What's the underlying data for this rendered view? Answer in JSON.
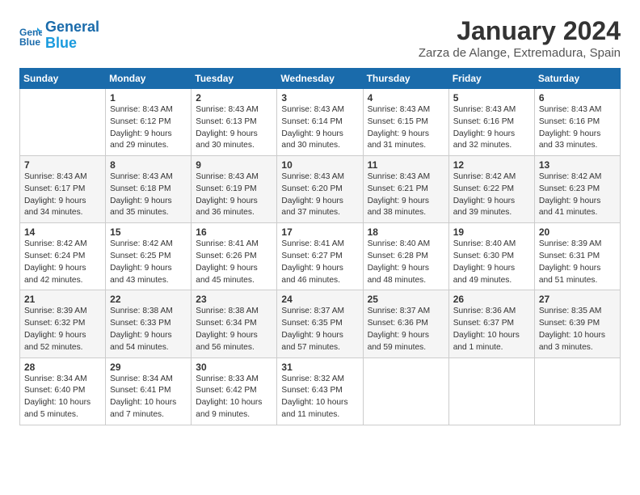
{
  "header": {
    "logo_line1": "General",
    "logo_line2": "Blue",
    "title": "January 2024",
    "subtitle": "Zarza de Alange, Extremadura, Spain"
  },
  "weekdays": [
    "Sunday",
    "Monday",
    "Tuesday",
    "Wednesday",
    "Thursday",
    "Friday",
    "Saturday"
  ],
  "rows": [
    [
      {
        "num": "",
        "lines": []
      },
      {
        "num": "1",
        "lines": [
          "Sunrise: 8:43 AM",
          "Sunset: 6:12 PM",
          "Daylight: 9 hours",
          "and 29 minutes."
        ]
      },
      {
        "num": "2",
        "lines": [
          "Sunrise: 8:43 AM",
          "Sunset: 6:13 PM",
          "Daylight: 9 hours",
          "and 30 minutes."
        ]
      },
      {
        "num": "3",
        "lines": [
          "Sunrise: 8:43 AM",
          "Sunset: 6:14 PM",
          "Daylight: 9 hours",
          "and 30 minutes."
        ]
      },
      {
        "num": "4",
        "lines": [
          "Sunrise: 8:43 AM",
          "Sunset: 6:15 PM",
          "Daylight: 9 hours",
          "and 31 minutes."
        ]
      },
      {
        "num": "5",
        "lines": [
          "Sunrise: 8:43 AM",
          "Sunset: 6:16 PM",
          "Daylight: 9 hours",
          "and 32 minutes."
        ]
      },
      {
        "num": "6",
        "lines": [
          "Sunrise: 8:43 AM",
          "Sunset: 6:16 PM",
          "Daylight: 9 hours",
          "and 33 minutes."
        ]
      }
    ],
    [
      {
        "num": "7",
        "lines": [
          "Sunrise: 8:43 AM",
          "Sunset: 6:17 PM",
          "Daylight: 9 hours",
          "and 34 minutes."
        ]
      },
      {
        "num": "8",
        "lines": [
          "Sunrise: 8:43 AM",
          "Sunset: 6:18 PM",
          "Daylight: 9 hours",
          "and 35 minutes."
        ]
      },
      {
        "num": "9",
        "lines": [
          "Sunrise: 8:43 AM",
          "Sunset: 6:19 PM",
          "Daylight: 9 hours",
          "and 36 minutes."
        ]
      },
      {
        "num": "10",
        "lines": [
          "Sunrise: 8:43 AM",
          "Sunset: 6:20 PM",
          "Daylight: 9 hours",
          "and 37 minutes."
        ]
      },
      {
        "num": "11",
        "lines": [
          "Sunrise: 8:43 AM",
          "Sunset: 6:21 PM",
          "Daylight: 9 hours",
          "and 38 minutes."
        ]
      },
      {
        "num": "12",
        "lines": [
          "Sunrise: 8:42 AM",
          "Sunset: 6:22 PM",
          "Daylight: 9 hours",
          "and 39 minutes."
        ]
      },
      {
        "num": "13",
        "lines": [
          "Sunrise: 8:42 AM",
          "Sunset: 6:23 PM",
          "Daylight: 9 hours",
          "and 41 minutes."
        ]
      }
    ],
    [
      {
        "num": "14",
        "lines": [
          "Sunrise: 8:42 AM",
          "Sunset: 6:24 PM",
          "Daylight: 9 hours",
          "and 42 minutes."
        ]
      },
      {
        "num": "15",
        "lines": [
          "Sunrise: 8:42 AM",
          "Sunset: 6:25 PM",
          "Daylight: 9 hours",
          "and 43 minutes."
        ]
      },
      {
        "num": "16",
        "lines": [
          "Sunrise: 8:41 AM",
          "Sunset: 6:26 PM",
          "Daylight: 9 hours",
          "and 45 minutes."
        ]
      },
      {
        "num": "17",
        "lines": [
          "Sunrise: 8:41 AM",
          "Sunset: 6:27 PM",
          "Daylight: 9 hours",
          "and 46 minutes."
        ]
      },
      {
        "num": "18",
        "lines": [
          "Sunrise: 8:40 AM",
          "Sunset: 6:28 PM",
          "Daylight: 9 hours",
          "and 48 minutes."
        ]
      },
      {
        "num": "19",
        "lines": [
          "Sunrise: 8:40 AM",
          "Sunset: 6:30 PM",
          "Daylight: 9 hours",
          "and 49 minutes."
        ]
      },
      {
        "num": "20",
        "lines": [
          "Sunrise: 8:39 AM",
          "Sunset: 6:31 PM",
          "Daylight: 9 hours",
          "and 51 minutes."
        ]
      }
    ],
    [
      {
        "num": "21",
        "lines": [
          "Sunrise: 8:39 AM",
          "Sunset: 6:32 PM",
          "Daylight: 9 hours",
          "and 52 minutes."
        ]
      },
      {
        "num": "22",
        "lines": [
          "Sunrise: 8:38 AM",
          "Sunset: 6:33 PM",
          "Daylight: 9 hours",
          "and 54 minutes."
        ]
      },
      {
        "num": "23",
        "lines": [
          "Sunrise: 8:38 AM",
          "Sunset: 6:34 PM",
          "Daylight: 9 hours",
          "and 56 minutes."
        ]
      },
      {
        "num": "24",
        "lines": [
          "Sunrise: 8:37 AM",
          "Sunset: 6:35 PM",
          "Daylight: 9 hours",
          "and 57 minutes."
        ]
      },
      {
        "num": "25",
        "lines": [
          "Sunrise: 8:37 AM",
          "Sunset: 6:36 PM",
          "Daylight: 9 hours",
          "and 59 minutes."
        ]
      },
      {
        "num": "26",
        "lines": [
          "Sunrise: 8:36 AM",
          "Sunset: 6:37 PM",
          "Daylight: 10 hours",
          "and 1 minute."
        ]
      },
      {
        "num": "27",
        "lines": [
          "Sunrise: 8:35 AM",
          "Sunset: 6:39 PM",
          "Daylight: 10 hours",
          "and 3 minutes."
        ]
      }
    ],
    [
      {
        "num": "28",
        "lines": [
          "Sunrise: 8:34 AM",
          "Sunset: 6:40 PM",
          "Daylight: 10 hours",
          "and 5 minutes."
        ]
      },
      {
        "num": "29",
        "lines": [
          "Sunrise: 8:34 AM",
          "Sunset: 6:41 PM",
          "Daylight: 10 hours",
          "and 7 minutes."
        ]
      },
      {
        "num": "30",
        "lines": [
          "Sunrise: 8:33 AM",
          "Sunset: 6:42 PM",
          "Daylight: 10 hours",
          "and 9 minutes."
        ]
      },
      {
        "num": "31",
        "lines": [
          "Sunrise: 8:32 AM",
          "Sunset: 6:43 PM",
          "Daylight: 10 hours",
          "and 11 minutes."
        ]
      },
      {
        "num": "",
        "lines": []
      },
      {
        "num": "",
        "lines": []
      },
      {
        "num": "",
        "lines": []
      }
    ]
  ]
}
